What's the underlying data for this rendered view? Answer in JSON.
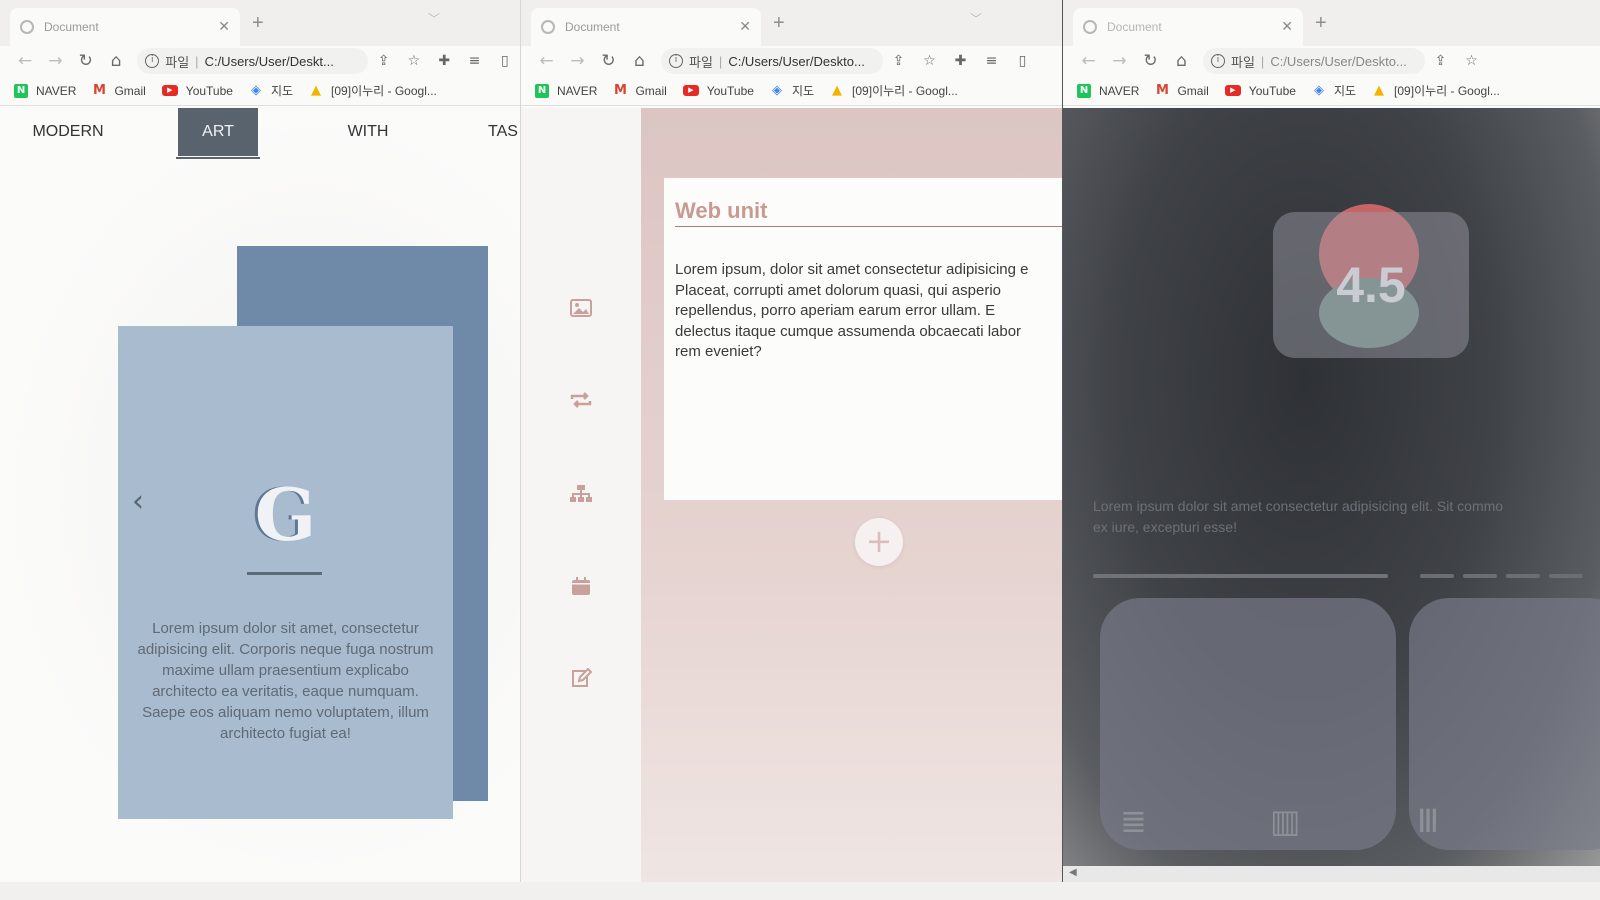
{
  "browser": {
    "tab_title": "Document",
    "new_tab": "+",
    "scheme_label": "파일",
    "bookmarks": [
      {
        "label": "NAVER",
        "icon": "naver-icon"
      },
      {
        "label": "Gmail",
        "icon": "gmail-icon"
      },
      {
        "label": "YouTube",
        "icon": "youtube-icon"
      },
      {
        "label": "지도",
        "icon": "maps-icon"
      },
      {
        "label": "[09]이누리 - Googl...",
        "icon": "drive-icon"
      }
    ]
  },
  "windows": [
    {
      "url": "C:/Users/User/Deskt...",
      "menu": [
        "MODERN",
        "ART",
        "WITH",
        "TAS"
      ],
      "active_menu": "ART",
      "card": {
        "letter": "G",
        "body": "Lorem ipsum dolor sit amet, consectetur adipisicing elit. Corporis neque fuga nostrum maxime ullam praesentium explicabo architecto ea veritatis, eaque numquam. Saepe eos aliquam nemo voluptatem, illum architecto fugiat ea!",
        "colors": {
          "back": "#6e8aa8",
          "front": "#a9bbce"
        }
      }
    },
    {
      "url": "C:/Users/User/Deskto...",
      "sidebar_icons": [
        "image-icon",
        "repeat-icon",
        "sitemap-icon",
        "calendar-icon",
        "edit-icon"
      ],
      "card": {
        "title": "Web unit",
        "lines": [
          "Lorem ipsum, dolor sit amet consectetur adipisicing e",
          "Placeat, corrupti amet dolorum quasi, qui asperio",
          "repellendus, porro aperiam earum error ullam. E",
          "delectus itaque cumque assumenda obcaecati labor",
          "rem eveniet?"
        ]
      },
      "add_label": "+",
      "accent": "#c99a92"
    },
    {
      "url": "C:/Users/User/Deskto...",
      "rating": "4.5",
      "text_lines": [
        "Lorem ipsum dolor sit amet consectetur adipisicing elit. Sit commo",
        "ex iure, excepturi esse!"
      ],
      "progress": 1.0,
      "tiles": [
        {
          "icon": "list-icon"
        },
        {
          "icon": "bar-chart-icon"
        },
        {
          "icon": "columns-icon"
        }
      ]
    }
  ]
}
